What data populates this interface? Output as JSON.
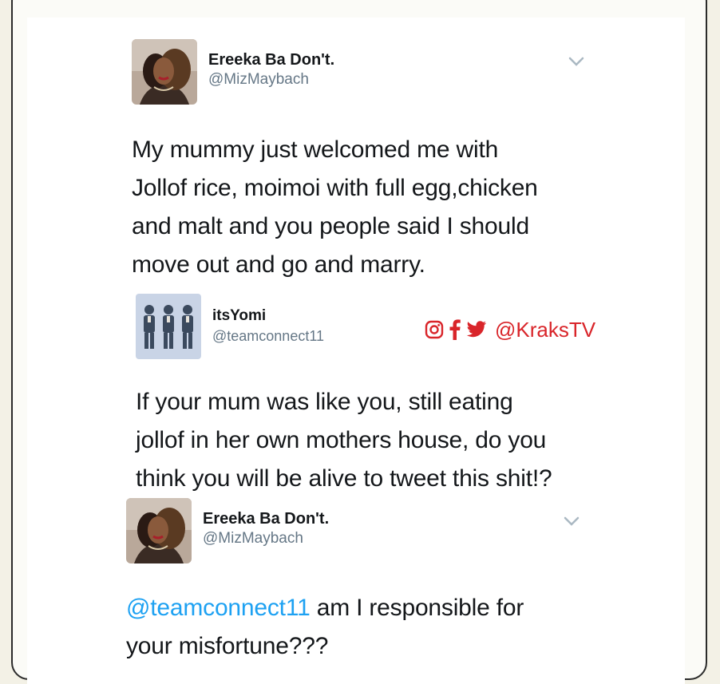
{
  "tweet1": {
    "name": "Ereeka Ba Don't.",
    "handle": "@MizMaybach",
    "lines": [
      "My mummy just welcomed me with",
      "Jollof rice, moimoi with full egg,chicken",
      "and malt and you people said I  should",
      "move out and go and marry."
    ]
  },
  "tweet2": {
    "name": "itsYomi",
    "handle": "@teamconnect11",
    "lines": [
      "If your mum was like you, still eating",
      "jollof in her own mothers house, do you",
      "think you will be alive to tweet this shit!?"
    ]
  },
  "tweet3": {
    "name": "Ereeka Ba Don't.",
    "handle": "@MizMaybach",
    "mention": "@teamconnect11",
    "line1_rest": " am I responsible for",
    "line2": "your misfortune???"
  },
  "watermark": {
    "text": "@KraksTV",
    "color": "#d9252a",
    "icons": [
      "instagram-icon",
      "facebook-icon",
      "twitter-icon"
    ]
  },
  "colors": {
    "mention": "#1da1f2",
    "handle": "#657786",
    "text": "#14171a"
  }
}
